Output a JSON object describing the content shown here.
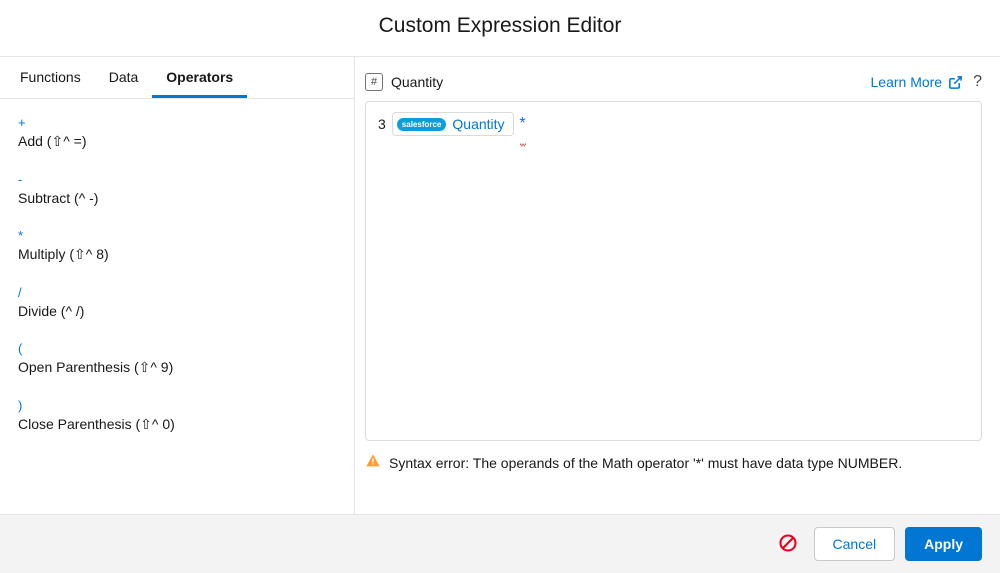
{
  "header": {
    "title": "Custom Expression Editor"
  },
  "tabs": {
    "functions": "Functions",
    "data": "Data",
    "operators": "Operators",
    "active": "operators"
  },
  "operators": [
    {
      "symbol": "+",
      "label": "Add (⇧^ =)"
    },
    {
      "symbol": "-",
      "label": "Subtract (^ -)"
    },
    {
      "symbol": "*",
      "label": "Multiply (⇧^ 8)"
    },
    {
      "symbol": "/",
      "label": "Divide (^ /)"
    },
    {
      "symbol": "(",
      "label": "Open Parenthesis (⇧^ 9)"
    },
    {
      "symbol": ")",
      "label": "Close Parenthesis (⇧^ 0)"
    }
  ],
  "field": {
    "type_icon": "#",
    "name": "Quantity",
    "learn_more": "Learn More"
  },
  "expression": {
    "prefix": "3",
    "pill_badge": "salesforce",
    "pill_label": "Quantity",
    "operator": "*"
  },
  "error": {
    "text": "Syntax error: The operands of the Math operator '*' must have data type NUMBER."
  },
  "footer": {
    "cancel": "Cancel",
    "apply": "Apply"
  }
}
